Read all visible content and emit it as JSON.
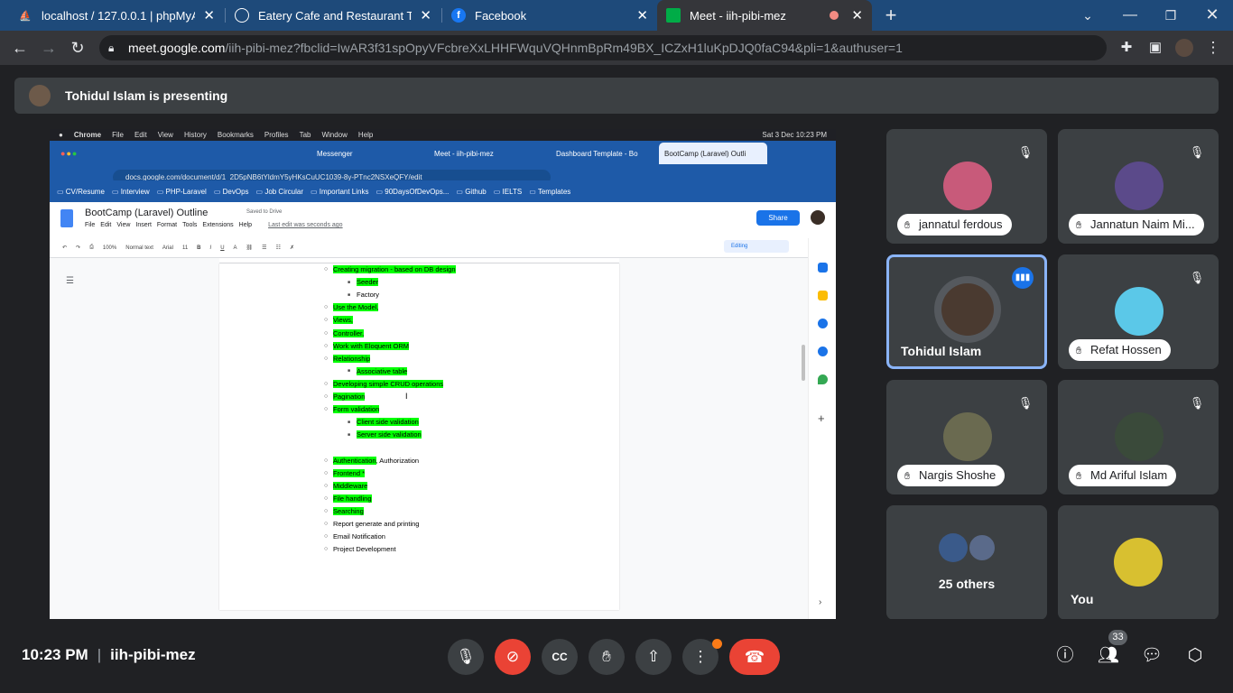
{
  "browser": {
    "tabs": [
      {
        "title": "localhost / 127.0.0.1 | phpMyAdm",
        "icon": "phpmyadmin-icon"
      },
      {
        "title": "Eatery Cafe and Restaurant Temp",
        "icon": "globe-icon"
      },
      {
        "title": "Facebook",
        "icon": "facebook-icon"
      },
      {
        "title": "Meet - iih-pibi-mez",
        "icon": "meet-icon",
        "active": true
      }
    ],
    "url_host": "meet.google.com",
    "url_rest": "/iih-pibi-mez?fbclid=IwAR3f31spOpyVFcbreXxLHHFWquVQHnmBpRm49BX_ICZxH1luKpDJQ0faC94&pli=1&authuser=1"
  },
  "presenting": {
    "text": "Tohidul Islam is presenting"
  },
  "shared_screen": {
    "mac_menu": [
      "Chrome",
      "File",
      "Edit",
      "View",
      "History",
      "Bookmarks",
      "Profiles",
      "Tab",
      "Window",
      "Help"
    ],
    "mac_clock": "Sat 3 Dec  10:23 PM",
    "tabs": [
      "Messenger",
      "Meet - iih-pibi-mez",
      "Dashboard Template - Bo",
      "BootCamp (Laravel) Outli"
    ],
    "url": "docs.google.com/document/d/1_2D5pNB6tYldmY5yHKsCuUC1039-8y-PTnc2NSXeQFY/edit",
    "bookmarks": [
      "CV/Resume",
      "Interview",
      "PHP-Laravel",
      "DevOps",
      "Job Circular",
      "Important Links",
      "90DaysOfDevOps...",
      "Github",
      "IELTS",
      "Templates"
    ],
    "doc_title": "BootCamp (Laravel) Outline",
    "saved": "Saved to Drive",
    "doc_menu": [
      "File",
      "Edit",
      "View",
      "Insert",
      "Format",
      "Tools",
      "Extensions",
      "Help"
    ],
    "last_edit": "Last edit was seconds ago",
    "share": "Share",
    "zoom": "100%",
    "style": "Normal text",
    "font": "Arial",
    "font_size": "11",
    "editing": "Editing",
    "lines": [
      {
        "text": "Creating migration - based on DB design",
        "level": 1,
        "hl": true
      },
      {
        "text": "Seeder",
        "level": 2,
        "hl": true
      },
      {
        "text": "Factory",
        "level": 2,
        "hl": false
      },
      {
        "text": "Use the Model,",
        "level": 1,
        "hl": true
      },
      {
        "text": "Views,",
        "level": 1,
        "hl": true
      },
      {
        "text": "Controller,",
        "level": 1,
        "hl": true
      },
      {
        "text": "Work with Eloquent ORM",
        "level": 1,
        "hl": true
      },
      {
        "text": "Relationship",
        "level": 1,
        "hl": true
      },
      {
        "text": "Associative table",
        "level": 2,
        "hl": true
      },
      {
        "text": "Developing simple CRUD operations",
        "level": 1,
        "hl": true
      },
      {
        "text": "Pagination",
        "level": 1,
        "hl": true
      },
      {
        "text": "Form validation",
        "level": 1,
        "hl": true
      },
      {
        "text": "Client side validation",
        "level": 2,
        "hl": true
      },
      {
        "text": "Server side validation",
        "level": 2,
        "hl": true
      },
      {
        "text": "",
        "level": 0,
        "hl": false
      },
      {
        "text": "Authentication",
        "extra": ", Authorization",
        "level": 1,
        "hl": true
      },
      {
        "text": "Frontend *",
        "level": 1,
        "hl": true
      },
      {
        "text": "Middleware",
        "level": 1,
        "hl": true
      },
      {
        "text": "File handling",
        "level": 1,
        "hl": true
      },
      {
        "text": "Searching",
        "level": 1,
        "hl": true
      },
      {
        "text": "Report generate and printing",
        "level": 1,
        "hl": false
      },
      {
        "text": "Email Notification",
        "level": 1,
        "hl": false
      },
      {
        "text": "Project Development",
        "level": 1,
        "hl": false
      }
    ]
  },
  "participants": [
    {
      "name": "jannatul ferdous",
      "muted": true,
      "face": "#c85a7a"
    },
    {
      "name": "Jannatun Naim Mi...",
      "muted": true,
      "face": "#5b4a8a"
    },
    {
      "name": "Tohidul Islam",
      "speaking": true,
      "face": "#4a3a30"
    },
    {
      "name": "Refat Hossen",
      "muted": true,
      "face": "#5bc8e8"
    },
    {
      "name": "Nargis Shoshe",
      "muted": true,
      "face": "#6a6a50"
    },
    {
      "name": "Md Ariful Islam",
      "muted": true,
      "face": "#3a4a3a"
    },
    {
      "name": "25 others"
    },
    {
      "name": "You",
      "face": "#d8c030"
    }
  ],
  "bottom": {
    "time": "10:23 PM",
    "meeting_code": "iih-pibi-mez",
    "people_count": "33"
  },
  "colors": {
    "end_call": "#ea4335",
    "highlight": "#00ff00",
    "speaking_border": "#8ab4f8",
    "tab_strip": "#1e4a7a"
  }
}
